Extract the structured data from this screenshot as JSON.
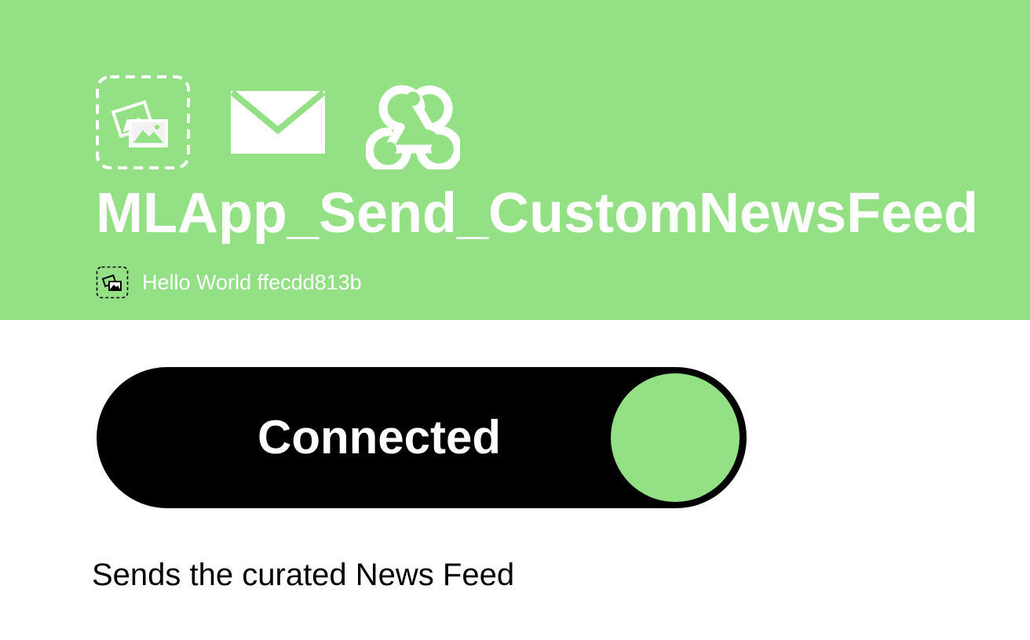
{
  "applet": {
    "title": "MLApp_Send_CustomNewsFeed",
    "owner": "Hello World ffecdd813b",
    "description": "Sends the curated News Feed",
    "icons": [
      "image-placeholder-icon",
      "email-icon",
      "webhook-icon"
    ]
  },
  "toggle": {
    "label": "Connected",
    "state": "on"
  },
  "colors": {
    "header_bg": "#93e184",
    "toggle_bg": "#000000",
    "knob": "#93e184",
    "text_light": "#ffffff",
    "text_dark": "#000000"
  }
}
